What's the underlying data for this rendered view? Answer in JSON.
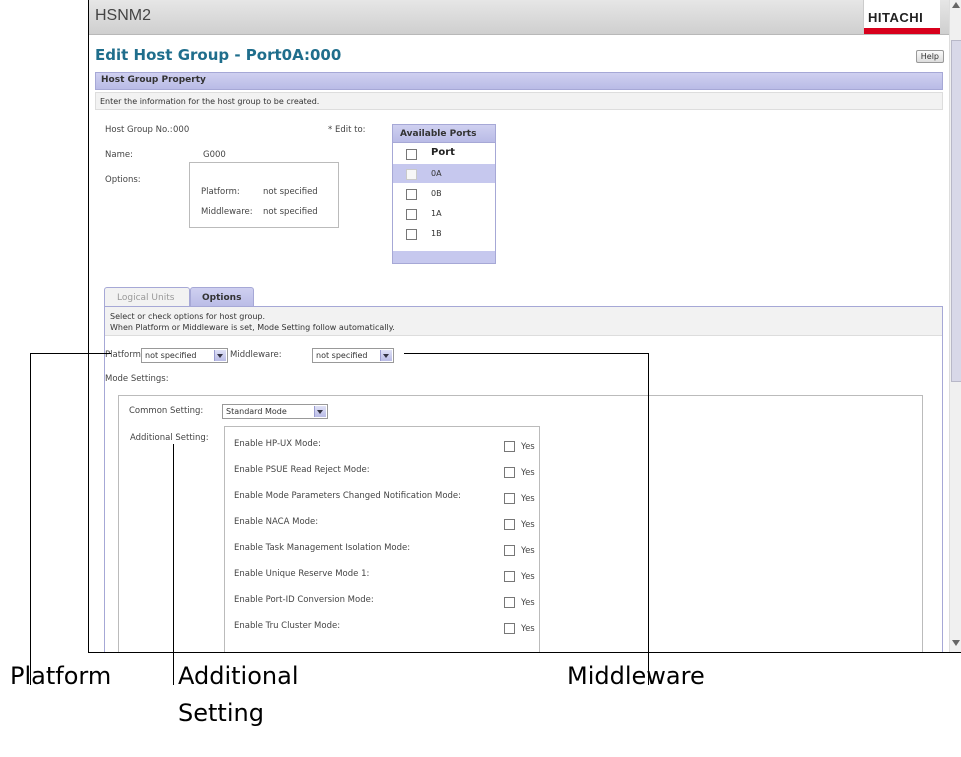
{
  "app": {
    "title": "HSNM2",
    "brand": "HITACHI"
  },
  "page": {
    "title": "Edit Host Group - Port0A:000",
    "help": "Help"
  },
  "property": {
    "section_title": "Host Group Property",
    "instruction": "Enter the information for the host group to be created.",
    "host_group_no_label": "Host Group No.:",
    "host_group_no": "000",
    "name_label": "Name:",
    "name": "G000",
    "options_label": "Options:",
    "platform_label": "Platform:",
    "platform_value": "not specified",
    "middleware_label": "Middleware:",
    "middleware_value": "not specified",
    "edit_to_label": "* Edit to:"
  },
  "ports": {
    "title": "Available Ports",
    "column": "Port",
    "rows": [
      {
        "label": "0A",
        "checked": true,
        "selected": true
      },
      {
        "label": "0B",
        "checked": false,
        "selected": false
      },
      {
        "label": "1A",
        "checked": false,
        "selected": false
      },
      {
        "label": "1B",
        "checked": false,
        "selected": false
      }
    ]
  },
  "tabs": {
    "logical_units": "Logical Units",
    "options": "Options"
  },
  "options_tab": {
    "instruction_1": "Select or check options for host group.",
    "instruction_2": "When Platform or Middleware is set, Mode Setting follow automatically.",
    "platform_label": "Platform:",
    "platform_value": "not specified",
    "middleware_label": "Middleware:",
    "middleware_value": "not specified",
    "mode_settings_label": "Mode Settings:",
    "common_setting_label": "Common Setting:",
    "common_setting_value": "Standard Mode",
    "additional_setting_label": "Additional Setting:",
    "yes_label": "Yes",
    "settings": [
      "Enable HP-UX Mode:",
      "Enable PSUE Read Reject Mode:",
      "Enable Mode Parameters Changed Notification Mode:",
      "Enable NACA Mode:",
      "Enable Task Management Isolation Mode:",
      "Enable Unique Reserve Mode 1:",
      "Enable Port-ID Conversion Mode:",
      "Enable Tru Cluster Mode:"
    ]
  },
  "annotations": {
    "platform": "Platform",
    "additional_setting_1": "Additional",
    "additional_setting_2": "Setting",
    "middleware": "Middleware"
  }
}
